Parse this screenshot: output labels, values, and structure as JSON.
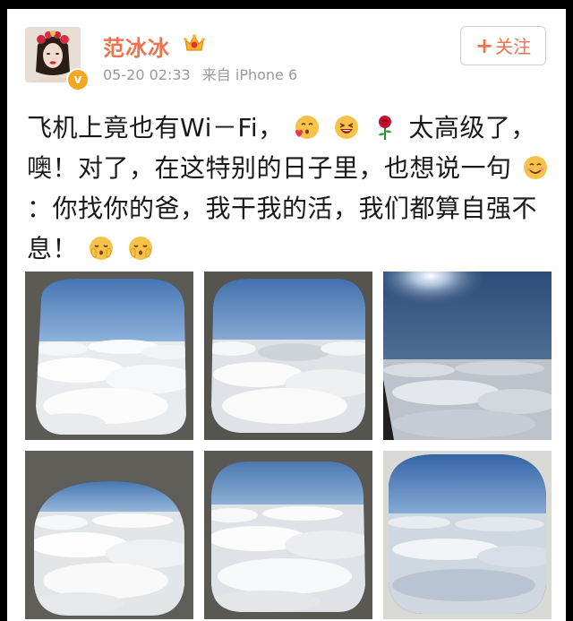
{
  "user": {
    "name": "范冰冰",
    "verified_mark": "v",
    "avatar_icon": "avatar-portrait",
    "vip_icon": "crown-vip-icon"
  },
  "meta": {
    "timestamp": "05-20 02:33",
    "source": "来自 iPhone 6"
  },
  "follow": {
    "plus": "+",
    "label": "关注"
  },
  "post": {
    "segment_1": "飞机上竟也有Wi－Fi，",
    "segment_2": "太高级了，噢！对了，在这特别的日子里，也想说一句",
    "segment_3": "：你找你的爸，我干我的活，我们都算自强不息！",
    "emojis": [
      "kiss-heart-emoji",
      "laugh-emoji",
      "rose-emoji",
      "smile-emoji",
      "blush-emoji",
      "blush-emoji"
    ]
  },
  "photos": [
    {
      "name": "airplane-window-photo-1"
    },
    {
      "name": "airplane-window-photo-2"
    },
    {
      "name": "airplane-window-photo-3"
    },
    {
      "name": "airplane-window-photo-4"
    },
    {
      "name": "airplane-window-photo-5"
    },
    {
      "name": "airplane-window-photo-6"
    }
  ],
  "colors": {
    "accent": "#eb7350",
    "meta_gray": "#9a9a9a",
    "badge": "#f5a623"
  }
}
